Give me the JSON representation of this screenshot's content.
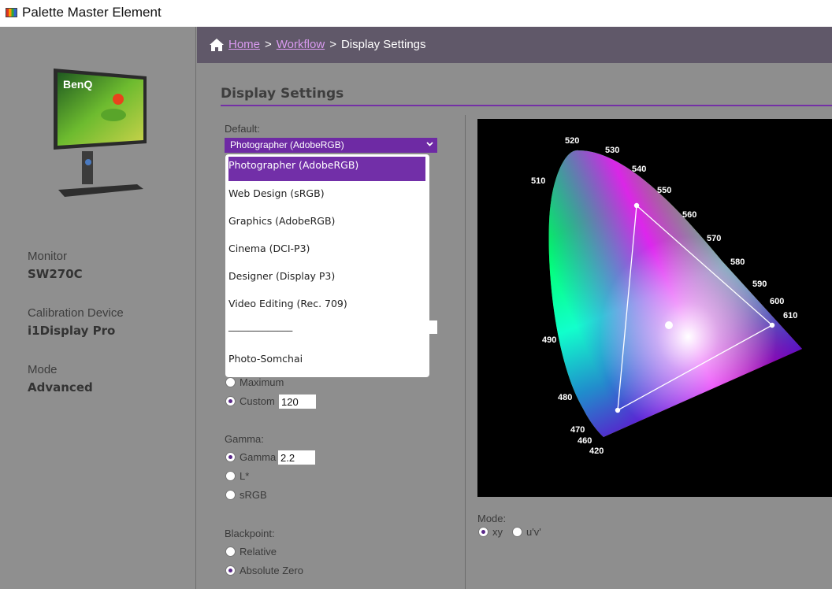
{
  "window": {
    "title": "Palette Master Element"
  },
  "sidebar": {
    "monitor_label": "Monitor",
    "monitor_value": "SW270C",
    "device_label": "Calibration Device",
    "device_value": "i1Display Pro",
    "mode_label": "Mode",
    "mode_value": "Advanced",
    "brand_text": "BenQ"
  },
  "breadcrumb": {
    "home": "Home",
    "sep1": ">",
    "workflow": "Workflow",
    "sep2": ">",
    "current": "Display Settings"
  },
  "settings": {
    "title": "Display Settings",
    "default_label": "Default:",
    "default_selected": "Photographer (AdobeRGB)",
    "options": [
      "Photographer (AdobeRGB)",
      "Web Design (sRGB)",
      "Graphics (AdobeRGB)",
      "Cinema (DCI-P3)",
      "Designer (Display P3)",
      "Video Editing (Rec. 709)",
      "_____________",
      "Photo-Somchai"
    ],
    "luminance": {
      "maximum_label": "Maximum",
      "custom_label": "Custom",
      "custom_value": "120",
      "selected": "Custom"
    },
    "gamma": {
      "label": "Gamma:",
      "gamma_option": "Gamma",
      "gamma_value": "2.2",
      "lstar": "L*",
      "srgb": "sRGB",
      "selected": "Gamma"
    },
    "blackpoint": {
      "label": "Blackpoint:",
      "relative": "Relative",
      "absolute_zero": "Absolute Zero",
      "selected": "Absolute Zero"
    }
  },
  "chromaticity": {
    "wavelength_labels": [
      "520",
      "530",
      "540",
      "550",
      "560",
      "570",
      "580",
      "590",
      "600",
      "610",
      "510",
      "490",
      "480",
      "470",
      "460",
      "420"
    ],
    "mode_label": "Mode:",
    "mode_xy": "xy",
    "mode_uv": "u'v'",
    "mode_selected": "xy"
  },
  "colors": {
    "accent": "#7430a6",
    "breadcrumb_bg": "#605869",
    "link": "#d99af0",
    "panel_bg": "#8e8e8e"
  }
}
